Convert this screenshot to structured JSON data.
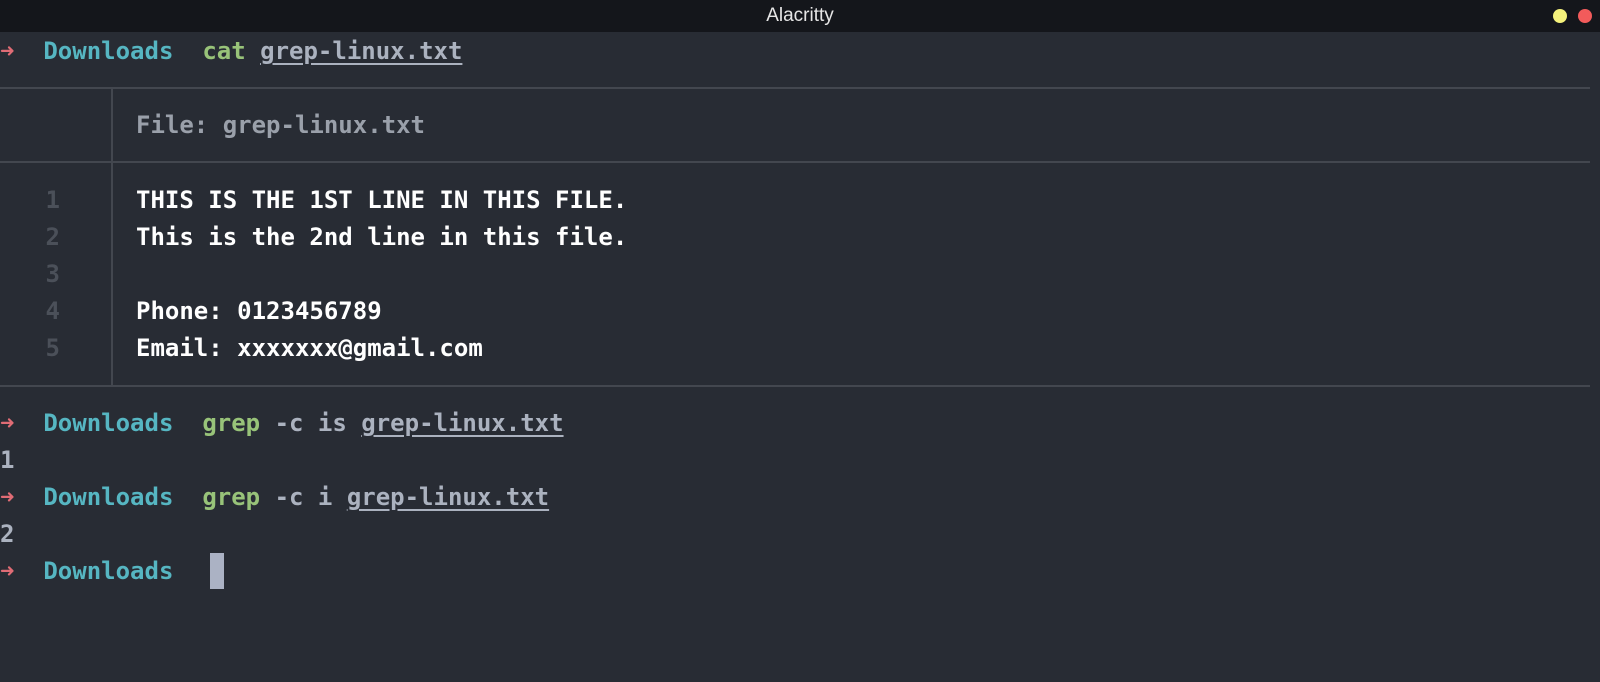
{
  "window": {
    "title": "Alacritty",
    "buttons": [
      {
        "name": "minimize",
        "color": "#f5f27c"
      },
      {
        "name": "close",
        "color": "#f25b5b"
      }
    ]
  },
  "prompt": {
    "symbol": "➜",
    "dir": "Downloads"
  },
  "commands": [
    {
      "cmd": "cat",
      "args": "",
      "file": "grep-linux.txt",
      "output": ""
    },
    {
      "cmd": "grep",
      "args": "-c is",
      "file": "grep-linux.txt",
      "output": "1"
    },
    {
      "cmd": "grep",
      "args": "-c i",
      "file": "grep-linux.txt",
      "output": "2"
    }
  ],
  "bat": {
    "header_label": "File: grep-linux.txt",
    "lines": [
      {
        "num": "1",
        "text": "THIS IS THE 1ST LINE IN THIS FILE."
      },
      {
        "num": "2",
        "text": "This is the 2nd line in this file."
      },
      {
        "num": "3",
        "text": ""
      },
      {
        "num": "4",
        "text": "Phone: 0123456789"
      },
      {
        "num": "5",
        "text": "Email: xxxxxxx@gmail.com"
      }
    ]
  },
  "colors": {
    "background": "#282c34",
    "titlebar": "#14161b",
    "arrow": "#e06c75",
    "dir": "#56b6c2",
    "command": "#98c379",
    "argument": "#abb2bf",
    "cursor": "#abb2c4"
  }
}
